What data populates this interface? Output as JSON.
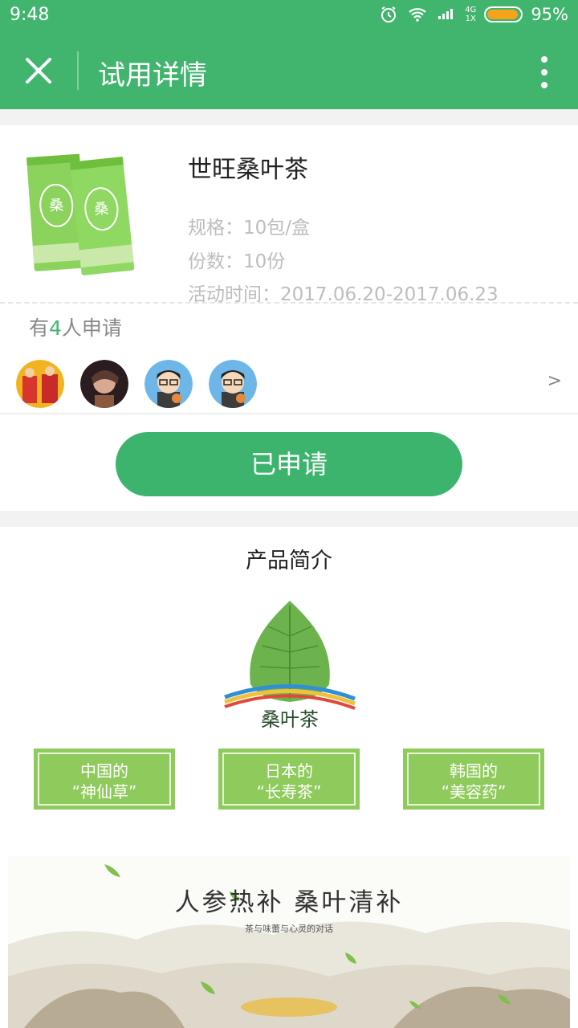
{
  "status_bar": {
    "time": "9:48",
    "network_top": "4G",
    "network_bottom": "1X",
    "battery": "95%",
    "battery_level": 0.95
  },
  "app_bar": {
    "title": "试用详情",
    "close_icon": "close-icon",
    "more_icon": "more-vertical-icon"
  },
  "product": {
    "name": "世旺桑叶茶",
    "spec": "规格：10包/盒",
    "quantity": "份数：10份",
    "period": "活动时间：2017.06.20-2017.06.23"
  },
  "applicants": {
    "prefix": "有",
    "count": "4",
    "suffix": "人申请",
    "more_arrow": ">"
  },
  "apply_button": "已申请",
  "intro": {
    "title": "产品简介",
    "logo_text": "桑叶茶",
    "boxes": [
      {
        "line1": "中国的",
        "line2": "“神仙草”"
      },
      {
        "line1": "日本的",
        "line2": "“长寿茶”"
      },
      {
        "line1": "韩国的",
        "line2": "“美容药”"
      }
    ],
    "slogan": "人参热补 桑叶清补",
    "slogan_sub": "茶与味蕾与心灵的对话"
  },
  "colors": {
    "brand": "#41b56e",
    "button": "#3db46d",
    "box_green": "#8fca5c"
  }
}
